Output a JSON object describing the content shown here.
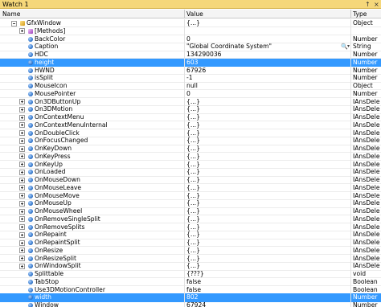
{
  "window": {
    "title": "Watch 1",
    "pin_glyph": "↑",
    "close_glyph": "×"
  },
  "columns": {
    "name": "Name",
    "value": "Value",
    "type": "Type"
  },
  "rows": [
    {
      "name": "GfxWindow",
      "value": "{...}",
      "type": "Object",
      "expander": "minus",
      "icon": "win",
      "indent": 1
    },
    {
      "name": "[Methods]",
      "value": "",
      "type": "",
      "expander": "plus",
      "icon": "meth",
      "indent": 2
    },
    {
      "name": "BackColor",
      "value": "0",
      "type": "Number",
      "expander": "",
      "icon": "prop",
      "indent": 2
    },
    {
      "name": "Caption",
      "value": "\"Global Coordinate System\"",
      "type": "String",
      "expander": "",
      "icon": "prop",
      "indent": 2
    },
    {
      "name": "HDC",
      "value": "134290036",
      "type": "Number",
      "expander": "",
      "icon": "prop",
      "indent": 2
    },
    {
      "name": "height",
      "value": "603",
      "type": "Number",
      "expander": "",
      "icon": "prop",
      "indent": 2,
      "selected": true
    },
    {
      "name": "HWND",
      "value": "67926",
      "type": "Number",
      "expander": "",
      "icon": "prop",
      "indent": 2
    },
    {
      "name": "isSplit",
      "value": "-1",
      "type": "Number",
      "expander": "",
      "icon": "prop",
      "indent": 2
    },
    {
      "name": "MouseIcon",
      "value": "null",
      "type": "Object",
      "expander": "",
      "icon": "prop",
      "indent": 2
    },
    {
      "name": "MousePointer",
      "value": "0",
      "type": "Number",
      "expander": "",
      "icon": "prop",
      "indent": 2
    },
    {
      "name": "On3DButtonUp",
      "value": "{...}",
      "type": "IAnsDele",
      "expander": "plus",
      "icon": "prop",
      "indent": 2
    },
    {
      "name": "On3DMotion",
      "value": "{...}",
      "type": "IAnsDele",
      "expander": "plus",
      "icon": "prop",
      "indent": 2
    },
    {
      "name": "OnContextMenu",
      "value": "{...}",
      "type": "IAnsDele",
      "expander": "plus",
      "icon": "prop",
      "indent": 2
    },
    {
      "name": "OnContextMenuInternal",
      "value": "{...}",
      "type": "IAnsDele",
      "expander": "plus",
      "icon": "prop",
      "indent": 2
    },
    {
      "name": "OnDoubleClick",
      "value": "{...}",
      "type": "IAnsDele",
      "expander": "plus",
      "icon": "prop",
      "indent": 2
    },
    {
      "name": "OnFocusChanged",
      "value": "{...}",
      "type": "IAnsDele",
      "expander": "plus",
      "icon": "prop",
      "indent": 2
    },
    {
      "name": "OnKeyDown",
      "value": "{...}",
      "type": "IAnsDele",
      "expander": "plus",
      "icon": "prop",
      "indent": 2
    },
    {
      "name": "OnKeyPress",
      "value": "{...}",
      "type": "IAnsDele",
      "expander": "plus",
      "icon": "prop",
      "indent": 2
    },
    {
      "name": "OnKeyUp",
      "value": "{...}",
      "type": "IAnsDele",
      "expander": "plus",
      "icon": "prop",
      "indent": 2
    },
    {
      "name": "OnLoaded",
      "value": "{...}",
      "type": "IAnsDele",
      "expander": "plus",
      "icon": "prop",
      "indent": 2
    },
    {
      "name": "OnMouseDown",
      "value": "{...}",
      "type": "IAnsDele",
      "expander": "plus",
      "icon": "prop",
      "indent": 2
    },
    {
      "name": "OnMouseLeave",
      "value": "{...}",
      "type": "IAnsDele",
      "expander": "plus",
      "icon": "prop",
      "indent": 2
    },
    {
      "name": "OnMouseMove",
      "value": "{...}",
      "type": "IAnsDele",
      "expander": "plus",
      "icon": "prop",
      "indent": 2
    },
    {
      "name": "OnMouseUp",
      "value": "{...}",
      "type": "IAnsDele",
      "expander": "plus",
      "icon": "prop",
      "indent": 2
    },
    {
      "name": "OnMouseWheel",
      "value": "{...}",
      "type": "IAnsDele",
      "expander": "plus",
      "icon": "prop",
      "indent": 2
    },
    {
      "name": "OnRemoveSingleSplit",
      "value": "{...}",
      "type": "IAnsDele",
      "expander": "plus",
      "icon": "prop",
      "indent": 2
    },
    {
      "name": "OnRemoveSplits",
      "value": "{...}",
      "type": "IAnsDele",
      "expander": "plus",
      "icon": "prop",
      "indent": 2
    },
    {
      "name": "OnRepaint",
      "value": "{...}",
      "type": "IAnsDele",
      "expander": "plus",
      "icon": "prop",
      "indent": 2
    },
    {
      "name": "OnRepaintSplit",
      "value": "{...}",
      "type": "IAnsDele",
      "expander": "plus",
      "icon": "prop",
      "indent": 2
    },
    {
      "name": "OnResize",
      "value": "{...}",
      "type": "IAnsDele",
      "expander": "plus",
      "icon": "prop",
      "indent": 2
    },
    {
      "name": "OnResizeSplit",
      "value": "{...}",
      "type": "IAnsDele",
      "expander": "plus",
      "icon": "prop",
      "indent": 2
    },
    {
      "name": "OnWindowSplit",
      "value": "{...}",
      "type": "IAnsDele",
      "expander": "plus",
      "icon": "prop",
      "indent": 2
    },
    {
      "name": "Splittable",
      "value": "{???}",
      "type": "void",
      "expander": "",
      "icon": "prop",
      "indent": 2
    },
    {
      "name": "TabStop",
      "value": "false",
      "type": "Boolean",
      "expander": "",
      "icon": "prop",
      "indent": 2
    },
    {
      "name": "Use3DMotionController",
      "value": "false",
      "type": "Boolean",
      "expander": "",
      "icon": "prop",
      "indent": 2
    },
    {
      "name": "width",
      "value": "802",
      "type": "Number",
      "expander": "",
      "icon": "prop",
      "indent": 2,
      "selected": true
    },
    {
      "name": "Window",
      "value": "67924",
      "type": "Number",
      "expander": "",
      "icon": "prop",
      "indent": 2
    }
  ],
  "caption_row_tools": {
    "search_glyph": "🔍",
    "dropdown_glyph": "▾"
  },
  "colors": {
    "titlebar": "#f5d77a",
    "selection": "#3399ff"
  }
}
